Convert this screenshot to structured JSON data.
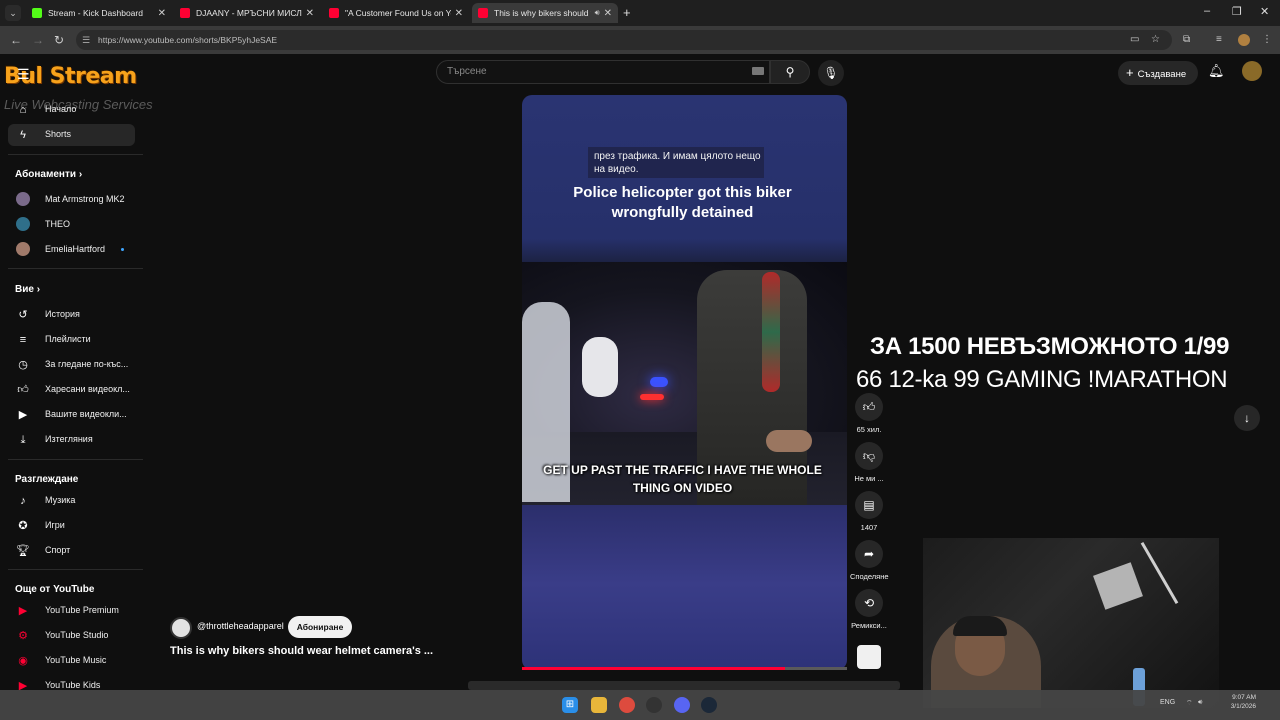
{
  "browser": {
    "tabs": [
      {
        "title": "Stream - Kick Dashboard",
        "favicon_color": "#53fc18"
      },
      {
        "title": "DJAANY - МРЪСНИ МИСЛИ (",
        "favicon_color": "#ff0033"
      },
      {
        "title": "\"A Customer Found Us on Yelp",
        "favicon_color": "#ff0033"
      },
      {
        "title": "This is why bikers should w",
        "favicon_color": "#ff0033"
      }
    ],
    "url": "https://www.youtube.com/shorts/BKP5yhJeSAE"
  },
  "header": {
    "logo_text": "Bul Stream",
    "logo_sub": "Live Webcasting Services",
    "search_placeholder": "Търсене",
    "create_label": "Създаване"
  },
  "sidebar": {
    "main": [
      {
        "label": "Начало",
        "icon": "home-icon"
      },
      {
        "label": "Shorts",
        "icon": "shorts-icon",
        "active": true
      }
    ],
    "subscriptions_heading": "Абонаменти",
    "subscriptions": [
      {
        "label": "Mat Armstrong MK2",
        "avatar_color": "#7a6a8a"
      },
      {
        "label": "THEO",
        "avatar_color": "#2f6f8a"
      },
      {
        "label": "EmeliaHartford",
        "avatar_color": "#a07a6a",
        "new": true
      }
    ],
    "you_heading": "Вие",
    "you": [
      {
        "label": "История",
        "icon": "history-icon"
      },
      {
        "label": "Плейлисти",
        "icon": "playlist-icon"
      },
      {
        "label": "За гледане по-къс...",
        "icon": "clock-icon"
      },
      {
        "label": "Харесани видеокл...",
        "icon": "like-icon"
      },
      {
        "label": "Вашите видеокли...",
        "icon": "video-icon"
      },
      {
        "label": "Изтегляния",
        "icon": "download-icon"
      }
    ],
    "explore_heading": "Разглеждане",
    "explore": [
      {
        "label": "Музика",
        "icon": "music-icon"
      },
      {
        "label": "Игри",
        "icon": "gaming-icon"
      },
      {
        "label": "Спорт",
        "icon": "trophy-icon"
      }
    ],
    "more_heading": "Още от YouTube",
    "more": [
      {
        "label": "YouTube Premium"
      },
      {
        "label": "YouTube Studio"
      },
      {
        "label": "YouTube Music"
      },
      {
        "label": "YouTube Kids"
      }
    ]
  },
  "video": {
    "subtitle_bg": "през трафика.  И имам цялото нещо на видео.",
    "overlay_top": "Police helicopter got this biker wrongfully detained",
    "overlay_bottom": "GET UP PAST THE TRAFFIC I HAVE THE WHOLE THING ON VIDEO",
    "progress": 0.81
  },
  "actions": {
    "likes": "65 хил.",
    "dislike": "Не ми ...",
    "comments": "1407",
    "share": "Споделяне",
    "remix": "Ремикси..."
  },
  "channel": {
    "handle": "@throttleheadapparel",
    "subscribe_label": "Абониране",
    "title": "This is why bikers should wear helmet camera's ..."
  },
  "stream_overlay": {
    "line1": "ЗА 1500 НЕВЪЗМОЖНОТО 1/99",
    "line2": "66 12-ka 99 GAMING !MARATHON"
  },
  "taskbar": {
    "time": "9:07 AM",
    "date": "3/1/2026",
    "lang": "ENG"
  }
}
